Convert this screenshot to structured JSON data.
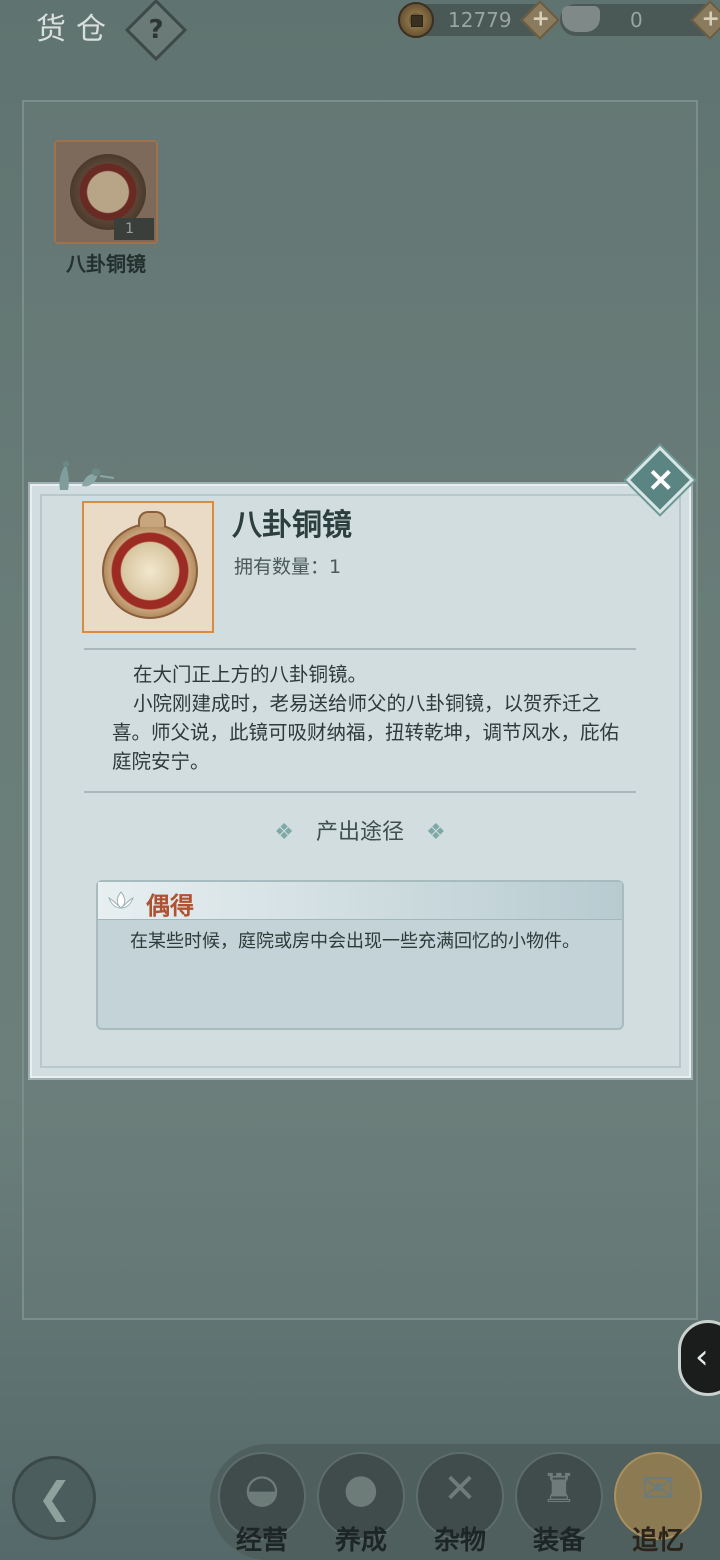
{
  "header": {
    "title": "货仓",
    "help_label": "?",
    "coins": {
      "value": "12779",
      "icon": "copper-coin-icon",
      "add_label": "+"
    },
    "ingots": {
      "value": "0",
      "icon": "silver-ingot-icon",
      "add_label": "+"
    }
  },
  "inventory": {
    "items": [
      {
        "name": "八卦铜镜",
        "count": "1",
        "icon": "bagua-mirror-icon"
      }
    ]
  },
  "popup": {
    "item_name": "八卦铜镜",
    "owned_label": "拥有数量：1",
    "description": [
      "在大门正上方的八卦铜镜。",
      "小院刚建成时，老易送给师父的八卦铜镜，以贺乔迁之喜。师父说，此镜可吸财纳福，扭转乾坤，调节风水，庇佑庭院安宁。"
    ],
    "source_title": "产出途径",
    "source": {
      "name": "偶得",
      "text": "在某些时候，庭院或房中会出现一些充满回忆的小物件。"
    }
  },
  "side_tab": {
    "icon": "chevron-left-icon",
    "glyph": "‹"
  },
  "bottom_nav": {
    "back_glyph": "❮",
    "items": [
      {
        "label": "经营",
        "icon": "bowl-icon",
        "glyph": "◒"
      },
      {
        "label": "养成",
        "icon": "pearl-icon",
        "glyph": "●"
      },
      {
        "label": "杂物",
        "icon": "bundle-icon",
        "glyph": "✕"
      },
      {
        "label": "装备",
        "icon": "robe-icon",
        "glyph": "♜"
      },
      {
        "label": "追忆",
        "icon": "letter-icon",
        "glyph": "✉"
      }
    ],
    "active_index": 4
  },
  "colors": {
    "popup_bg": "#d2dde0",
    "accent_frame": "#d98b3e",
    "source_name": "#b0512f",
    "close_button": "#5a8583"
  }
}
